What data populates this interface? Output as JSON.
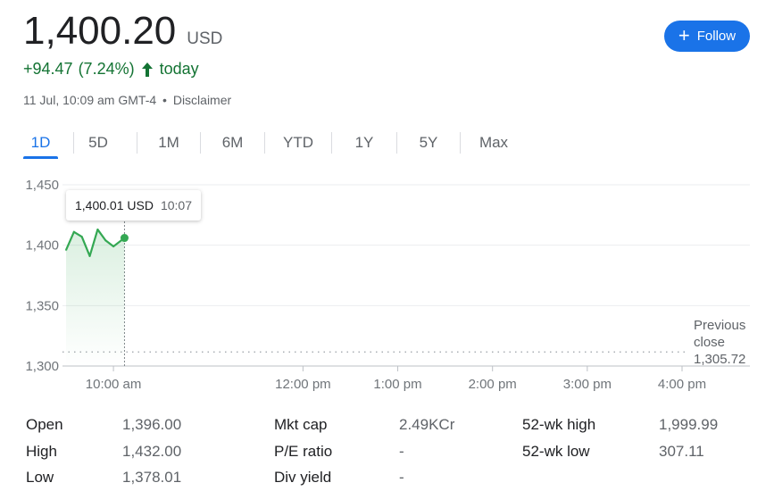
{
  "quote": {
    "price": "1,400.20",
    "currency": "USD",
    "change": "+94.47",
    "change_pct": "(7.24%)",
    "period": "today",
    "timestamp": "11 Jul, 10:09 am GMT-4",
    "separator": "•",
    "disclaimer": "Disclaimer"
  },
  "follow": {
    "label": "Follow",
    "icon": "plus-icon"
  },
  "tabs": [
    {
      "label": "1D",
      "active": true
    },
    {
      "label": "5D"
    },
    {
      "label": "1M"
    },
    {
      "label": "6M"
    },
    {
      "label": "YTD"
    },
    {
      "label": "1Y"
    },
    {
      "label": "5Y"
    },
    {
      "label": "Max"
    }
  ],
  "tooltip": {
    "value": "1,400.01 USD",
    "time": "10:07"
  },
  "chart_data": {
    "type": "line",
    "y_ticks": [
      "1,450",
      "1,400",
      "1,350",
      "1,300"
    ],
    "y_tick_values": [
      1450,
      1400,
      1350,
      1300
    ],
    "x_ticks": [
      "10:00 am",
      "12:00 pm",
      "1:00 pm",
      "2:00 pm",
      "3:00 pm",
      "4:00 pm"
    ],
    "ylim": [
      1300,
      1450
    ],
    "series": [
      {
        "x": [
          "9:30",
          "9:35",
          "9:40",
          "9:45",
          "9:50",
          "9:55",
          "10:00",
          "10:07"
        ],
        "values": [
          1396,
          1411,
          1407,
          1391,
          1413,
          1404,
          1399,
          1406
        ]
      }
    ],
    "previous_close_label_line1": "Previous",
    "previous_close_label_line2": "close",
    "previous_close": 1305.72,
    "previous_close_text": "1,305.72",
    "line_color": "#34a853"
  },
  "stats": {
    "open_label": "Open",
    "open_value": "1,396.00",
    "high_label": "High",
    "high_value": "1,432.00",
    "low_label": "Low",
    "low_value": "1,378.01",
    "mktcap_label": "Mkt cap",
    "mktcap_value": "2.49KCr",
    "pe_label": "P/E ratio",
    "pe_value": "-",
    "div_label": "Div yield",
    "div_value": "-",
    "wkhigh_label": "52-wk high",
    "wkhigh_value": "1,999.99",
    "wklow_label": "52-wk low",
    "wklow_value": "307.11"
  }
}
